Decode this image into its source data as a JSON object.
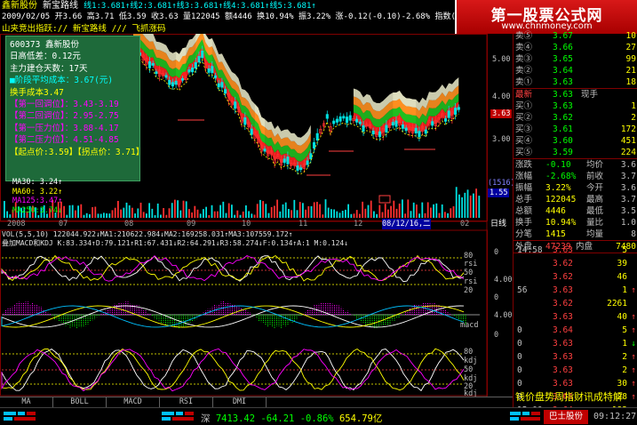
{
  "header": {
    "line1": {
      "stock_name": "鑫新股份",
      "indicator": "新宝路线",
      "values": "线1:3.681↑线2:3.681↑线3:3.681↑线4:3.681↑线5:3.681↑",
      "tail": "图1"
    },
    "line2": {
      "date": "2009/02/05",
      "open": "开3.66",
      "high": "高3.71",
      "low": "低3.59",
      "close": "收3.63",
      "volume": "量122045",
      "amount": "额4446",
      "turnover": "换10.94%",
      "amp": "振3.22%",
      "change": "涨-0.12(-0.10)-2.68%",
      "index": "指数(-9.73)-0.46%"
    },
    "line3": "山夹竞出指跃:// 新宝路线 /// 飞抓涨码"
  },
  "watermark": {
    "title": "第一股票公式网",
    "url": "www.chnmoney.com"
  },
  "infobox": {
    "lines": [
      {
        "text": "600373 鑫新股份",
        "color": "white"
      },
      {
        "text": "日高低差：0.12元",
        "color": "white"
      },
      {
        "text": "主力建仓天数：17天",
        "color": "white"
      },
      {
        "text": "■阶段平均成本：3.67(元)",
        "color": "cyan"
      },
      {
        "text": "换手成本3.47",
        "color": "yellow"
      },
      {
        "text": "【第一回调位】：3.43-3.19",
        "color": "magenta"
      },
      {
        "text": "【第二回调位】：2.95-2.75",
        "color": "magenta"
      },
      {
        "text": "【第一压力位】：3.88-4.17",
        "color": "magenta"
      },
      {
        "text": "【第二压力位】：4.51-4.85",
        "color": "magenta"
      },
      {
        "text": "【起点价:3.59】【拐点价：3.71】",
        "color": "yellow"
      }
    ]
  },
  "ma_legend": [
    "MA30: 3.24↑",
    "MA60: 3.22↑",
    "MA125:3.47↑",
    "MA250:3.74↓"
  ],
  "price_axis": [
    "5.00",
    "4.00",
    "3.63",
    "3.00",
    "(1516)",
    "1.55"
  ],
  "time_axis": [
    "2008",
    "07",
    "08",
    "09",
    "10",
    "11",
    "12",
    "08/12/16,二",
    "02",
    "日线"
  ],
  "indicator_bar": {
    "vol": "VOL(5,5,10) 122044.922↓MA1:210622.984↓MA2:169258.031↑MA3:107559.172↑",
    "macd": "叠加MACD和KDJ K:83.334↑D:79.121↑R1:67.431↓R2:64.291↓R3:58.274↓F:0.134↑A:1 M:0.124↓"
  },
  "rsi_labels": [
    "80",
    "rsi",
    "50",
    "rsi",
    "20"
  ],
  "macd_labels": [
    "macd"
  ],
  "kdj_labels": [
    "80",
    "kdj",
    "50",
    "kdj",
    "20",
    "kdj"
  ],
  "right_scale": [
    "0",
    "4.00",
    "0",
    "4.00",
    "0"
  ],
  "tabs": [
    "MA",
    "BOLL",
    "MACD",
    "RSI",
    "DMI"
  ],
  "ticker": {
    "market": "深",
    "index_value": "7413.42",
    "change": "-64.21",
    "pct": "-0.86%",
    "amount": "654.79亿"
  },
  "bulletin": "钱价盘势周指财讯成特解",
  "status": {
    "stock": "巴士股份",
    "time": "09:12:27"
  },
  "quote": {
    "sell": [
      {
        "label": "卖⑤",
        "price": "3.67",
        "vol": "10"
      },
      {
        "label": "卖④",
        "price": "3.66",
        "vol": "27"
      },
      {
        "label": "卖③",
        "price": "3.65",
        "vol": "99"
      },
      {
        "label": "卖②",
        "price": "3.64",
        "vol": "21"
      },
      {
        "label": "卖①",
        "price": "3.63",
        "vol": "18"
      }
    ],
    "last": {
      "label": "最新",
      "price": "3.63",
      "extra": "现手"
    },
    "buy": [
      {
        "label": "买①",
        "price": "3.63",
        "vol": "1"
      },
      {
        "label": "买②",
        "price": "3.62",
        "vol": "2"
      },
      {
        "label": "买③",
        "price": "3.61",
        "vol": "172"
      },
      {
        "label": "买④",
        "price": "3.60",
        "vol": "451"
      },
      {
        "label": "买⑤",
        "price": "3.59",
        "vol": "224"
      }
    ],
    "stats": [
      {
        "l1": "涨跌",
        "v1": "-0.10",
        "l2": "均价",
        "v2": "3.6"
      },
      {
        "l1": "涨幅",
        "v1": "-2.68%",
        "l2": "前收",
        "v2": "3.7"
      },
      {
        "l1": "振幅",
        "v1": "3.22%",
        "l2": "今开",
        "v2": "3.6"
      },
      {
        "l1": "总手",
        "v1": "122045",
        "l2": "最高",
        "v2": "3.7"
      },
      {
        "l1": "总额",
        "v1": "4446",
        "l2": "最低",
        "v2": "3.5"
      },
      {
        "l1": "换手",
        "v1": "10.94%",
        "l2": "量比",
        "v2": "1.0"
      },
      {
        "l1": "分笔",
        "v1": "1415",
        "l2": "均量",
        "v2": "8"
      }
    ],
    "outer": {
      "l1": "外盘",
      "v1": "47239",
      "l2": "内盘",
      "v2": "7480"
    },
    "ticks": [
      {
        "time": "14:58",
        "price": "3.63",
        "vol": "5",
        "arrow": ""
      },
      {
        "time": "",
        "price": "3.62",
        "vol": "39",
        "arrow": ""
      },
      {
        "time": "",
        "price": "3.62",
        "vol": "46",
        "arrow": ""
      },
      {
        "time": "56",
        "price": "3.63",
        "vol": "1",
        "arrow": "up"
      },
      {
        "time": "",
        "price": "3.62",
        "vol": "2261",
        "arrow": ""
      },
      {
        "time": "",
        "price": "3.63",
        "vol": "40",
        "arrow": "up"
      },
      {
        "time": "0",
        "price": "3.64",
        "vol": "5",
        "arrow": "up"
      },
      {
        "time": "0",
        "price": "3.63",
        "vol": "1",
        "arrow": "down"
      },
      {
        "time": "0",
        "price": "3.63",
        "vol": "2",
        "arrow": "up"
      },
      {
        "time": "0",
        "price": "3.63",
        "vol": "2",
        "arrow": "up"
      },
      {
        "time": "0",
        "price": "3.63",
        "vol": "30",
        "arrow": "up"
      },
      {
        "time": "0",
        "price": "3.64",
        "vol": "28",
        "arrow": "up"
      },
      {
        "time": "15:00",
        "price": "3.64",
        "vol": "183",
        "arrow": ""
      }
    ],
    "price_tag": "3.63"
  }
}
